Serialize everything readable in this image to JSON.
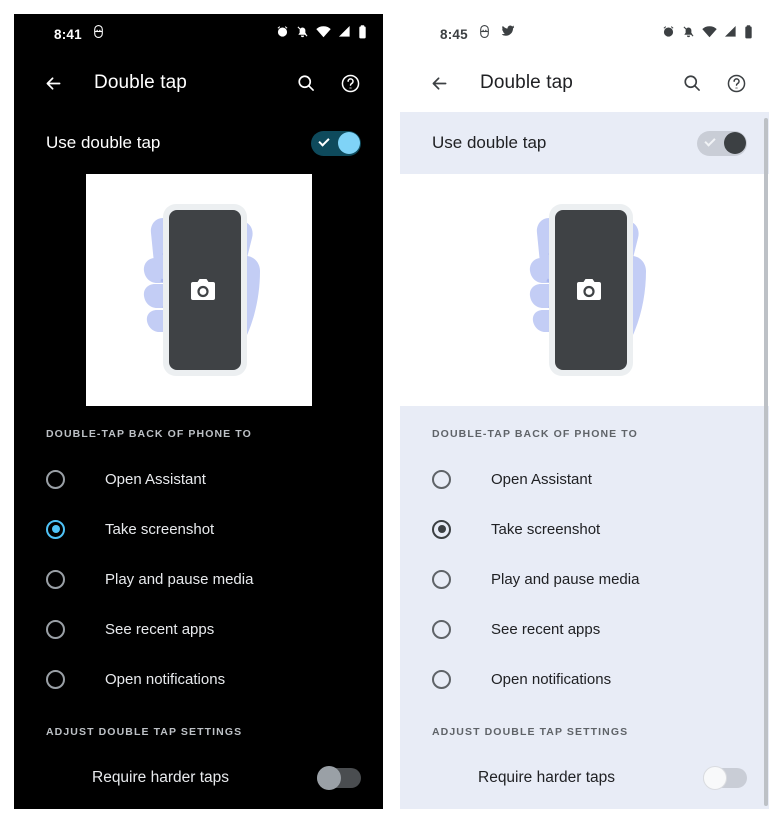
{
  "panels": [
    {
      "theme": "dark",
      "status_bar": {
        "time": "8:41",
        "left_icons": [
          "app-notification-icon"
        ],
        "right_icons": [
          "alarm-icon",
          "notifications-muted-icon",
          "wifi-icon",
          "cellular-signal-icon",
          "battery-icon"
        ]
      },
      "app_bar": {
        "back_label": "Back",
        "title": "Double tap",
        "search_label": "Search",
        "help_label": "Help"
      },
      "main_toggle": {
        "label": "Use double tap",
        "state": "on"
      },
      "illustration": {
        "name": "hand-holding-phone-illustration",
        "screen_icon": "camera-icon"
      },
      "section_action": {
        "header": "DOUBLE-TAP BACK OF PHONE TO",
        "options": [
          {
            "label": "Open Assistant",
            "selected": false
          },
          {
            "label": "Take screenshot",
            "selected": true
          },
          {
            "label": "Play and pause media",
            "selected": false
          },
          {
            "label": "See recent apps",
            "selected": false
          },
          {
            "label": "Open notifications",
            "selected": false
          }
        ]
      },
      "section_adjust": {
        "header": "ADJUST DOUBLE TAP SETTINGS",
        "rows": [
          {
            "label": "Require harder taps",
            "state": "off"
          }
        ]
      }
    },
    {
      "theme": "light",
      "status_bar": {
        "time": "8:45",
        "left_icons": [
          "app-notification-icon",
          "twitter-icon"
        ],
        "right_icons": [
          "alarm-icon",
          "notifications-muted-icon",
          "wifi-icon",
          "cellular-signal-icon",
          "battery-icon"
        ]
      },
      "app_bar": {
        "back_label": "Back",
        "title": "Double tap",
        "search_label": "Search",
        "help_label": "Help"
      },
      "main_toggle": {
        "label": "Use double tap",
        "state": "on"
      },
      "illustration": {
        "name": "hand-holding-phone-illustration",
        "screen_icon": "camera-icon"
      },
      "section_action": {
        "header": "DOUBLE-TAP BACK OF PHONE TO",
        "options": [
          {
            "label": "Open Assistant",
            "selected": false
          },
          {
            "label": "Take screenshot",
            "selected": true
          },
          {
            "label": "Play and pause media",
            "selected": false
          },
          {
            "label": "See recent apps",
            "selected": false
          },
          {
            "label": "Open notifications",
            "selected": false
          }
        ]
      },
      "section_adjust": {
        "header": "ADJUST DOUBLE TAP SETTINGS",
        "rows": [
          {
            "label": "Require harder taps",
            "state": "off"
          }
        ]
      }
    }
  ],
  "colors": {
    "dark_background": "#000000",
    "dark_text": "#ffffff",
    "light_background": "#ffffff",
    "light_band": "#e8ecf6",
    "light_list_background": "#e8ecf6",
    "accent_selected_dark": "#4fc3f7",
    "accent_selected_light": "#3c4043",
    "switch_on_track_dark": "#0e4a5c",
    "switch_on_thumb_dark": "#7fd3f7",
    "switch_on_track_light": "#c9cdd6",
    "switch_on_thumb_light": "#3c4043",
    "illustration_hand": "#c3cdf5",
    "illustration_phone": "#3f4245"
  }
}
